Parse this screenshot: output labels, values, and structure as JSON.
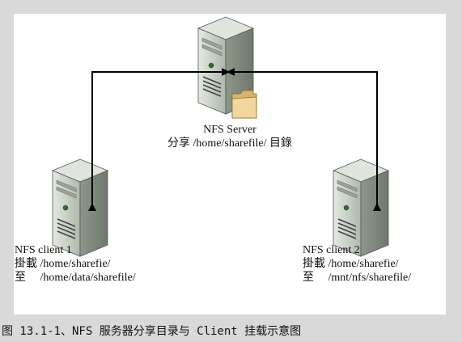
{
  "server": {
    "name": "NFS Server",
    "share_line": "分享 /home/sharefile/ 目錄"
  },
  "client1": {
    "name": "NFS client 1",
    "mount_line": "掛載 /home/sharefie/",
    "target_line": "至　 /home/data/sharefile/"
  },
  "client2": {
    "name": "NFS client 2",
    "mount_line": "掛載 /home/sharefie/",
    "target_line": "至　 /mnt/nfs/sharefile/"
  },
  "caption": "图 13.1-1、NFS 服务器分享目录与 Client 挂载示意图",
  "icons": [
    "server-tower-icon",
    "folder-icon",
    "client-tower-icon"
  ],
  "colors": {
    "page_bg": "#d9d9d9",
    "figure_bg": "#ffffff",
    "arrow": "#000000",
    "tower": "#c8d0c4",
    "folder": "#e9c98a"
  }
}
